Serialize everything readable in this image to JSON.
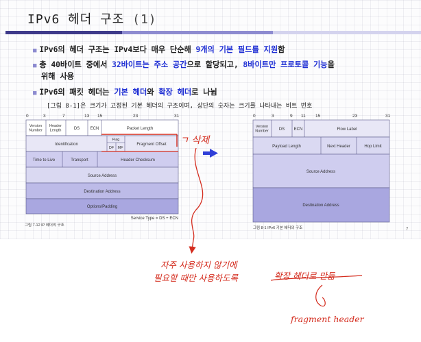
{
  "slide": {
    "title_main": "IPv6 헤더 구조",
    "title_num": "(1)",
    "bullets": [
      {
        "p1": "IPv6의 헤더 구조는 IPv4보다 매우 단순해 ",
        "h1": "9개의 기본 필드를 지원",
        "p2": "함"
      },
      {
        "p1": "총 40바이트 중에서 ",
        "h1": "32바이트는 주소 공간",
        "p2": "으로 할당되고, ",
        "h2": "8바이트만 프로토콜 기능",
        "p3": "을",
        "line2": "위해 사용"
      },
      {
        "p1": "IPv6의 패킷 헤더는 ",
        "h1": "기본 헤더",
        "p2": "와 ",
        "h2": "확장 헤더",
        "p3": "로 나뉨"
      }
    ],
    "caption": "[그림 8-1]은 크기가 고정된 기본 헤더의 구조이며, 상단의 숫자는 크기를 나타내는 비트 번호",
    "colors": {
      "title_bar_dark": "#3e3a8a",
      "title_bar_mid": "#8d8bd0",
      "highlight": "#1f2fd4",
      "annotation": "#d42c1e"
    }
  },
  "ipv4": {
    "bit_labels": [
      "0",
      "3",
      "7",
      "13",
      "15",
      "23",
      "31"
    ],
    "fields": {
      "version": "Version\nNumber",
      "header_length": "Header\nLength",
      "ds": "DS",
      "ecn": "ECN",
      "packet_length": "Packet Length",
      "identification": "Identification",
      "flag": "Flag",
      "df": "DF",
      "mf": "MF",
      "fragment_offset": "Fragment Offset",
      "ttl": "Time to Live",
      "transport": "Transport",
      "header_checksum": "Header Checksum",
      "source": "Source Address",
      "destination": "Destination Address",
      "options": "Options/Padding"
    },
    "note": "Service Type = DS + ECN",
    "caption": "그림 7-12 IP 헤더의 구조"
  },
  "ipv6": {
    "bit_labels": [
      "0",
      "3",
      "9",
      "11",
      "15",
      "23",
      "31"
    ],
    "fields": {
      "version": "Version\nNumber",
      "ds": "DS",
      "ecn": "ECN",
      "flow_label": "Flow Label",
      "payload_length": "Payload Length",
      "next_header": "Next Header",
      "hop_limit": "Hop Limit",
      "source": "Source Address",
      "destination": "Destination Address"
    },
    "caption": "그림 8-1 IPv6 기본 헤더의 구조",
    "page_mark": "7"
  },
  "annotations": {
    "deleted": "ㄱ 삭제",
    "line1": "자주 사용하지 않기에",
    "line2": "필요할 때만 사용하도록",
    "line3": "확장 헤더로 만듦",
    "line4": "fragment header"
  }
}
